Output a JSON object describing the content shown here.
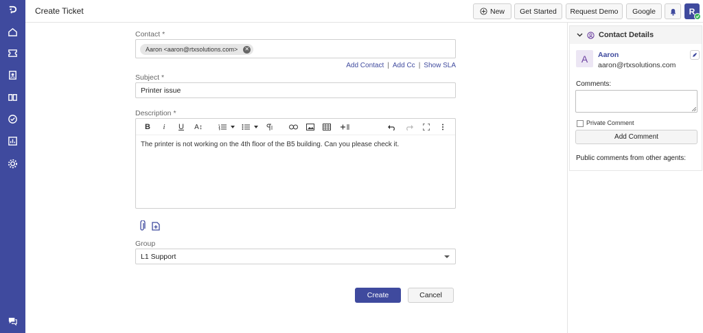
{
  "header": {
    "title": "Create Ticket",
    "buttons": {
      "new": "New",
      "get_started": "Get Started",
      "request_demo": "Request Demo",
      "google": "Google"
    },
    "avatar_letter": "R"
  },
  "nav": {
    "items": [
      "logo-icon",
      "home-icon",
      "tickets-icon",
      "contacts-icon",
      "knowledge-base-icon",
      "tasks-icon",
      "reports-icon",
      "settings-icon"
    ],
    "chat": "chat-icon"
  },
  "form": {
    "contact_label": "Contact *",
    "contact_chip": "Aaron <aaron@rtxsolutions.com>",
    "links": {
      "add_contact": "Add Contact",
      "add_cc": "Add Cc",
      "show_sla": "Show SLA",
      "separator": "|"
    },
    "subject_label": "Subject *",
    "subject_value": "Printer issue",
    "description_label": "Description *",
    "description_value": "The printer is not working on the 4th floor of the B5 building. Can you please check it.",
    "toolbar": {
      "bold": "B",
      "italic": "i",
      "underline": "U",
      "font_size": "A↕"
    },
    "group_label": "Group",
    "group_value": "L1 Support",
    "create": "Create",
    "cancel": "Cancel"
  },
  "contact_panel": {
    "title": "Contact Details",
    "avatar_letter": "A",
    "name": "Aaron",
    "email": "aaron@rtxsolutions.com",
    "comments_label": "Comments:",
    "private_comment": "Private Comment",
    "add_comment": "Add Comment",
    "public_comments": "Public comments from other agents:"
  },
  "colors": {
    "brand": "#3f4a9e",
    "online": "#3cb45a",
    "avatar_bg": "#ece6f4"
  }
}
